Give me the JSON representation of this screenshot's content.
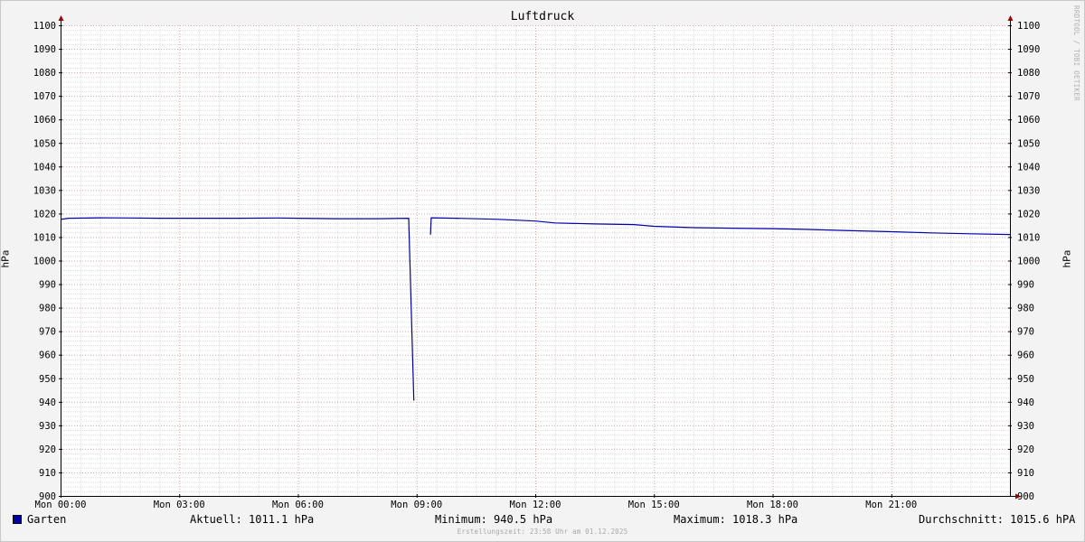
{
  "chart_data": {
    "type": "line",
    "title": "Luftdruck",
    "ylabel": "hPa",
    "ylim": [
      900,
      1100
    ],
    "yticks": [
      900,
      910,
      920,
      930,
      940,
      950,
      960,
      970,
      980,
      990,
      1000,
      1010,
      1020,
      1030,
      1040,
      1050,
      1060,
      1070,
      1080,
      1090,
      1100
    ],
    "x_range_hours": [
      0,
      24
    ],
    "xticks": [
      {
        "hour": 0,
        "label": "Mon 00:00"
      },
      {
        "hour": 3,
        "label": "Mon 03:00"
      },
      {
        "hour": 6,
        "label": "Mon 06:00"
      },
      {
        "hour": 9,
        "label": "Mon 09:00"
      },
      {
        "hour": 12,
        "label": "Mon 12:00"
      },
      {
        "hour": 15,
        "label": "Mon 15:00"
      },
      {
        "hour": 18,
        "label": "Mon 18:00"
      },
      {
        "hour": 21,
        "label": "Mon 21:00"
      }
    ],
    "grid": true,
    "legend_position": "bottom-left",
    "series": [
      {
        "name": "Garten",
        "color": "#0000a8",
        "segments": [
          [
            [
              0.0,
              1017.5
            ],
            [
              0.2,
              1018.0
            ],
            [
              1.0,
              1018.2
            ],
            [
              1.8,
              1018.1
            ],
            [
              2.5,
              1018.0
            ],
            [
              3.5,
              1018.0
            ],
            [
              4.5,
              1018.0
            ],
            [
              5.5,
              1018.1
            ],
            [
              6.0,
              1018.0
            ],
            [
              7.0,
              1017.8
            ],
            [
              8.0,
              1017.8
            ],
            [
              8.8,
              1018.0
            ],
            [
              8.93,
              940.5
            ]
          ],
          [
            [
              9.35,
              1011.0
            ],
            [
              9.37,
              1018.2
            ],
            [
              10.0,
              1018.0
            ],
            [
              11.0,
              1017.6
            ],
            [
              12.0,
              1016.8
            ],
            [
              12.5,
              1016.0
            ],
            [
              13.5,
              1015.6
            ],
            [
              14.5,
              1015.3
            ],
            [
              15.0,
              1014.6
            ],
            [
              16.0,
              1014.0
            ],
            [
              17.0,
              1013.8
            ],
            [
              18.0,
              1013.6
            ],
            [
              19.0,
              1013.2
            ],
            [
              20.0,
              1012.7
            ],
            [
              21.0,
              1012.3
            ],
            [
              22.0,
              1011.8
            ],
            [
              23.0,
              1011.4
            ],
            [
              24.0,
              1011.1
            ]
          ]
        ]
      }
    ]
  },
  "legend": {
    "series_label": "Garten",
    "aktuell": "Aktuell: 1011.1 hPa",
    "minimum": "Minimum: 940.5 hPa",
    "maximum": "Maximum: 1018.3 hPa",
    "durchschnitt": "Durchschnitt: 1015.6 hPA"
  },
  "footer": "Erstellungszeit: 23:58 Uhr am 01.12.2025",
  "watermark": "RRDTOOL / TOBI OETIKER"
}
